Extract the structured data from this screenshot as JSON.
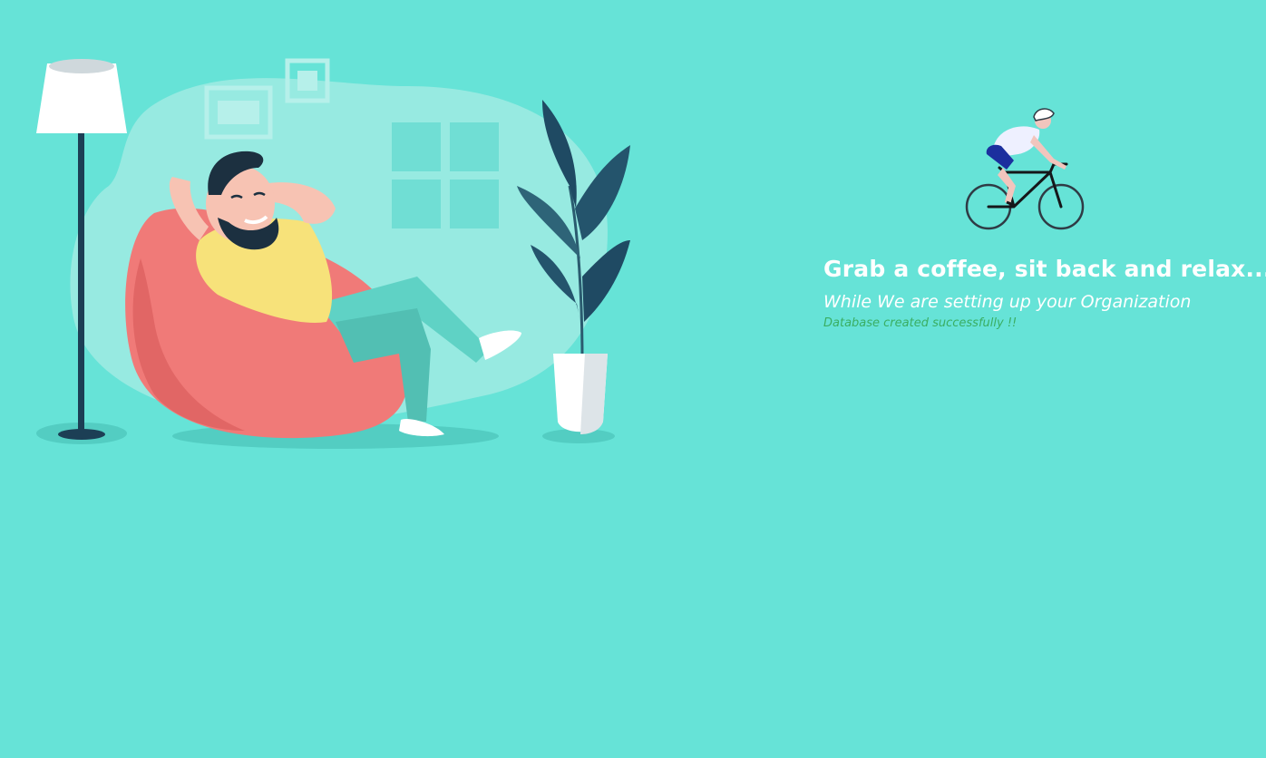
{
  "loading_screen": {
    "headline": "Grab a coffee, sit back and relax....",
    "subline": "While We are setting up your Organization",
    "status": "Database created successfully !!"
  },
  "icons": {
    "illustration": "relaxing-man-beanbag-illustration",
    "loader": "cyclist-loading-icon"
  },
  "colors": {
    "background": "#66e3d7",
    "headline": "#ffffff",
    "status_success": "#3aae62",
    "beanbag": "#f07a78",
    "plant": "#2a5b6f"
  }
}
